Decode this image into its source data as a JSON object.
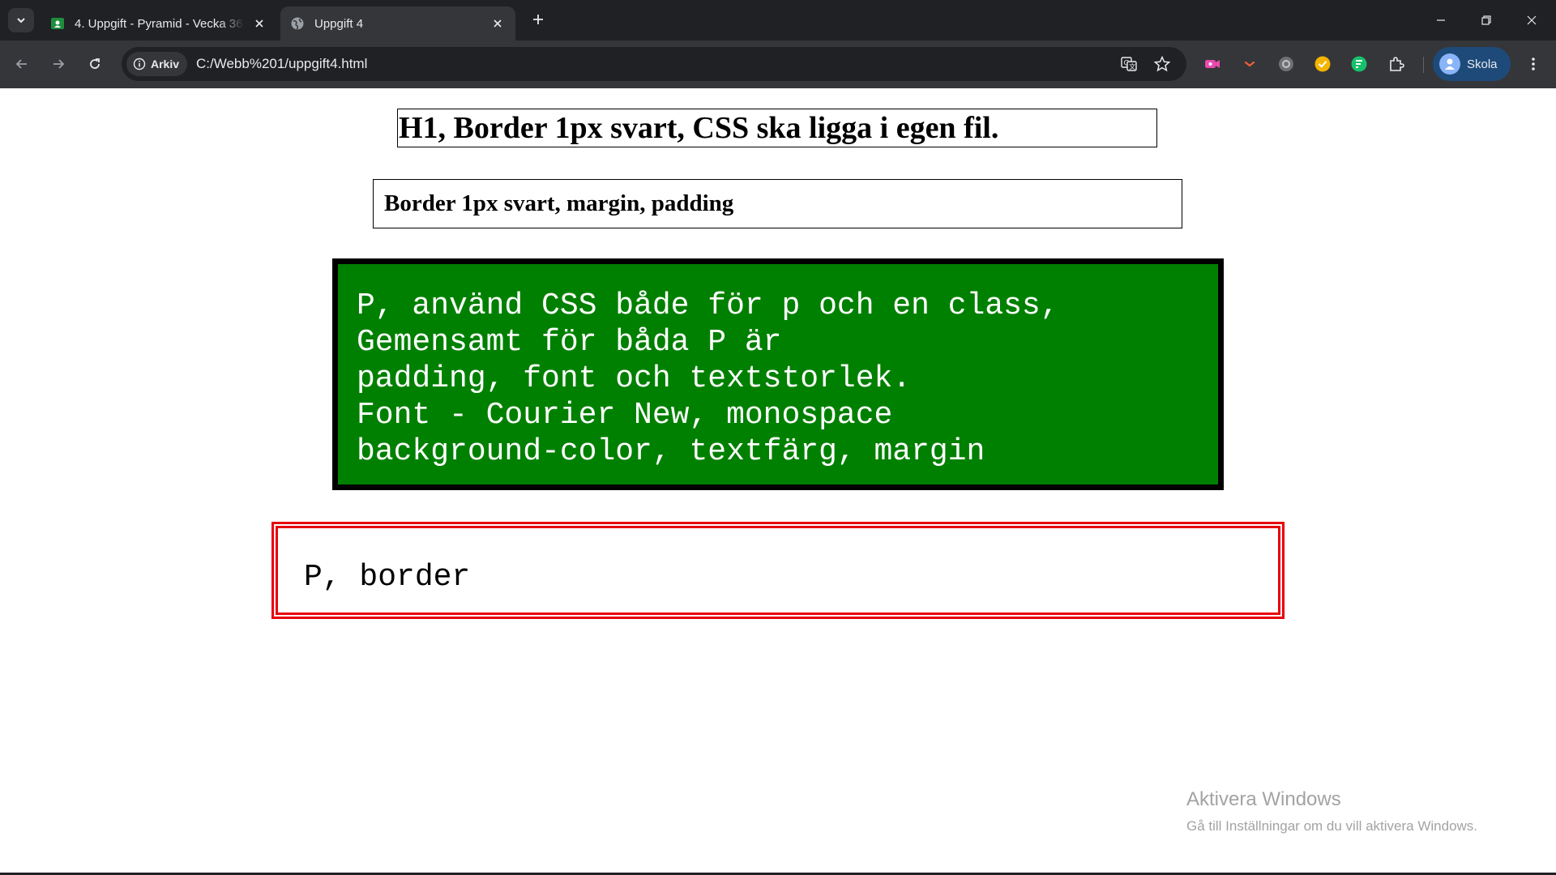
{
  "browser": {
    "tabs": [
      {
        "title": "4. Uppgift - Pyramid - Vecka 36",
        "active": false,
        "favicon": "classroom-icon"
      },
      {
        "title": "Uppgift 4",
        "active": true,
        "favicon": "globe-icon"
      }
    ],
    "address_chip": "Arkiv",
    "url": "C:/Webb%201/uppgift4.html",
    "profile_name": "Skola"
  },
  "page": {
    "h1": "H1, Border 1px svart, CSS ska ligga i egen fil.",
    "h3": "Border 1px svart, margin, padding",
    "green_p": {
      "lines": [
        "P, använd CSS både för p och en class,",
        "Gemensamt för båda P är",
        "padding, font och textstorlek.",
        "Font - Courier New, monospace",
        "background-color, textfärg, margin"
      ],
      "background": "#008000",
      "color": "#ffffff"
    },
    "border_p": "P, border",
    "border_color": "#e8000b"
  },
  "watermark": {
    "title": "Aktivera Windows",
    "subtitle": "Gå till Inställningar om du vill aktivera Windows."
  }
}
